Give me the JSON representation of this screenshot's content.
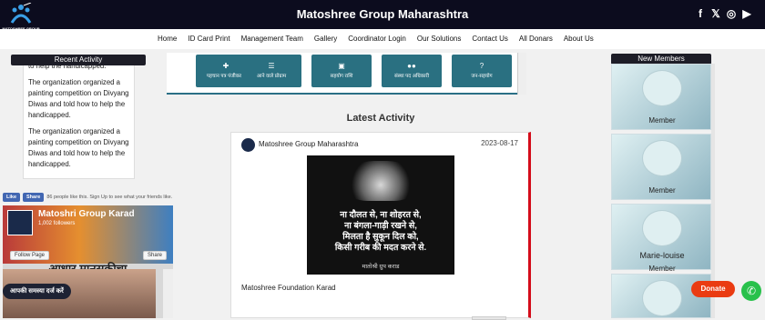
{
  "header": {
    "title": "Matoshree Group Maharashtra",
    "logo_text_1": "MATOSHREE GROUP",
    "logo_text_2": "MAHARASHTRA",
    "social": [
      "facebook-icon",
      "twitter-icon",
      "instagram-icon",
      "youtube-icon"
    ],
    "social_glyphs": [
      "f",
      "𝕏",
      "◎",
      "▶"
    ]
  },
  "nav": {
    "items": [
      "Home",
      "ID Card Print",
      "Management Team",
      "Gallery",
      "Coordinator Login",
      "Our Solutions",
      "Contact Us",
      "All Donars",
      "About Us"
    ]
  },
  "recent_activity": {
    "title": "Recent Activity",
    "partial_top": "to help the handicapped.",
    "items": [
      "The organization organized a painting competition on Divyang Diwas and told how to help the handicapped.",
      "The organization organized a painting competition on Divyang Diwas and told how to help the handicapped."
    ]
  },
  "fb_like": {
    "like_label": "Like",
    "share_label": "Share",
    "text": "86 people like this. Sign Up to see what your friends like."
  },
  "fb_page": {
    "name": "Matoshri Group Karad",
    "followers": "1,002 followers",
    "follow_label": "Follow Page",
    "share_label": "Share",
    "banner_text": "आधार मानसकीचा"
  },
  "problem_button": "आपकी समस्या दर्ज करें",
  "quick_links": [
    {
      "label": "पहचान पत्र पंजीकरण",
      "icon": "user-plus-icon",
      "glyph": "✚"
    },
    {
      "label": "आने वाले प्रोग्राम",
      "icon": "list-icon",
      "glyph": "☰"
    },
    {
      "label": "सहयोग राशि",
      "icon": "money-icon",
      "glyph": "▣"
    },
    {
      "label": "संस्था पद अधिकारी",
      "icon": "group-icon",
      "glyph": "●●"
    },
    {
      "label": "जन-सहयोग",
      "icon": "question-icon",
      "glyph": "?"
    }
  ],
  "latest": {
    "title": "Latest Activity",
    "org_name": "Matoshree Group Maharashtra",
    "date": "2023-08-17",
    "image_lines": [
      "ना दौलत से, ना शोहरत से,",
      "ना बंगला-गाड़ी रखने से,",
      "मिलता है सुकून दिल को,",
      "किसी गरीब की मदत करने से."
    ],
    "image_sign": "मातोश्री ग्रुप कराड",
    "caption": "Matoshree Foundation Karad"
  },
  "new_members": {
    "title": "New Members",
    "items": [
      {
        "name": "",
        "label": "Member"
      },
      {
        "name": "",
        "label": "Member"
      },
      {
        "name": "Marie-louise",
        "label": "Member"
      },
      {
        "name": "",
        "label": ""
      }
    ]
  },
  "donate_label": "Donate",
  "whatsapp_glyph": "✆",
  "colors": {
    "topbar": "#0c0c1e",
    "accent_teal": "#2a7081",
    "donate": "#ea3b12",
    "whatsapp": "#28c14b",
    "card_border": "#d40c1a"
  }
}
